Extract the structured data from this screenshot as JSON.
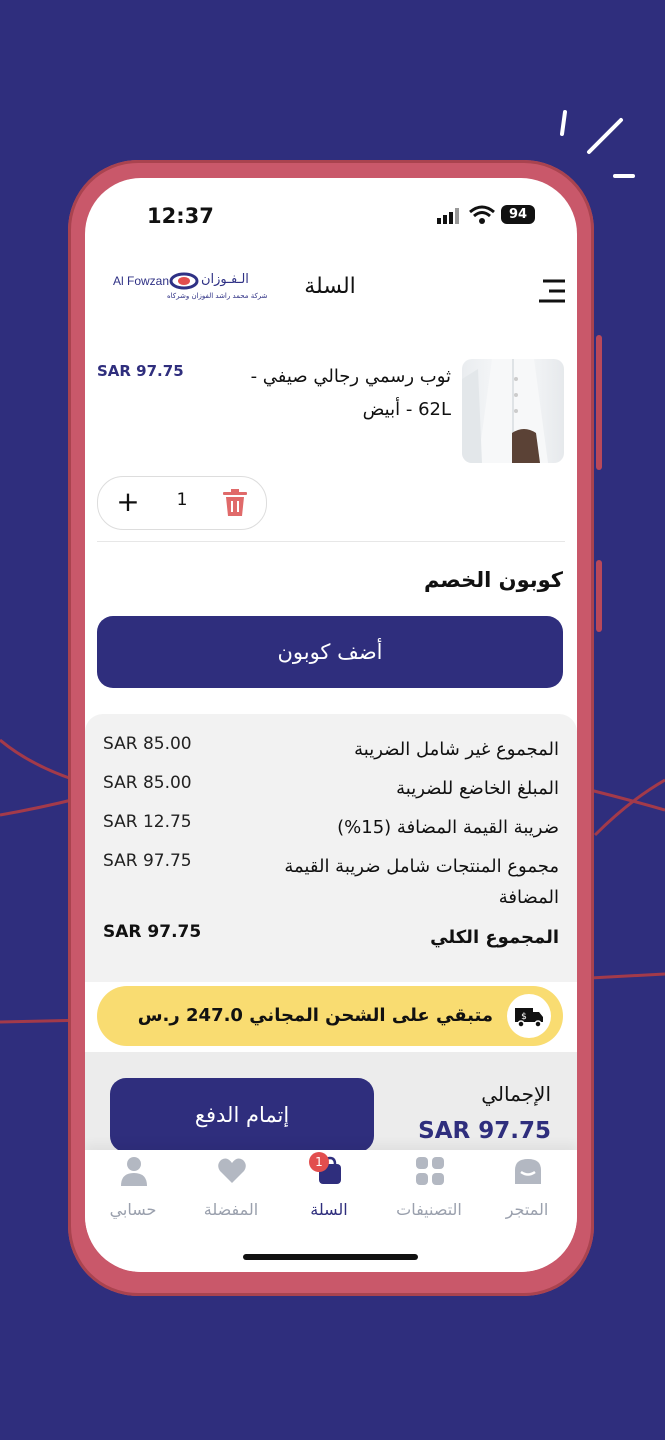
{
  "status": {
    "time": "12:37",
    "battery": "94"
  },
  "header": {
    "title": "السلة",
    "logo_en": "Al Fowzan",
    "logo_ar": "الـفـوزان",
    "logo_sub": "شركة محمد راشد الفوزان وشركاه"
  },
  "product": {
    "name": "ثوب رسمي  رجالي صيفي - 62L - أبيض",
    "price": "SAR 97.75",
    "quantity": "1"
  },
  "coupon": {
    "title": "كوبون الخصم",
    "button": "أضف كوبون"
  },
  "summary": {
    "rows": [
      {
        "label": "المجموع غير شامل الضريبة",
        "value": "SAR 85.00"
      },
      {
        "label": "المبلغ الخاضع للضريبة",
        "value": "SAR 85.00"
      },
      {
        "label": "ضريبة القيمة المضافة (15%)",
        "value": "SAR 12.75"
      },
      {
        "label": "مجموع المنتجات شامل ضريبة القيمة المضافة",
        "value": "SAR 97.75"
      }
    ],
    "grand_label": "المجموع الكلي",
    "grand_value": "SAR 97.75"
  },
  "shipping": {
    "text": "متبقي على الشحن المجاني 247.0 ر.س"
  },
  "checkout": {
    "button": "إتمام الدفع",
    "total_label": "الإجمالي",
    "total_value": "SAR 97.75"
  },
  "nav": {
    "store": "المتجر",
    "categories": "التصنيفات",
    "cart": "السلة",
    "cart_badge": "1",
    "favorites": "المفضلة",
    "account": "حسابي"
  },
  "colors": {
    "primary": "#2f2e7d",
    "phone_frame": "#c9586a",
    "shipping_bar": "#f9dc71",
    "badge": "#e24e4e"
  }
}
